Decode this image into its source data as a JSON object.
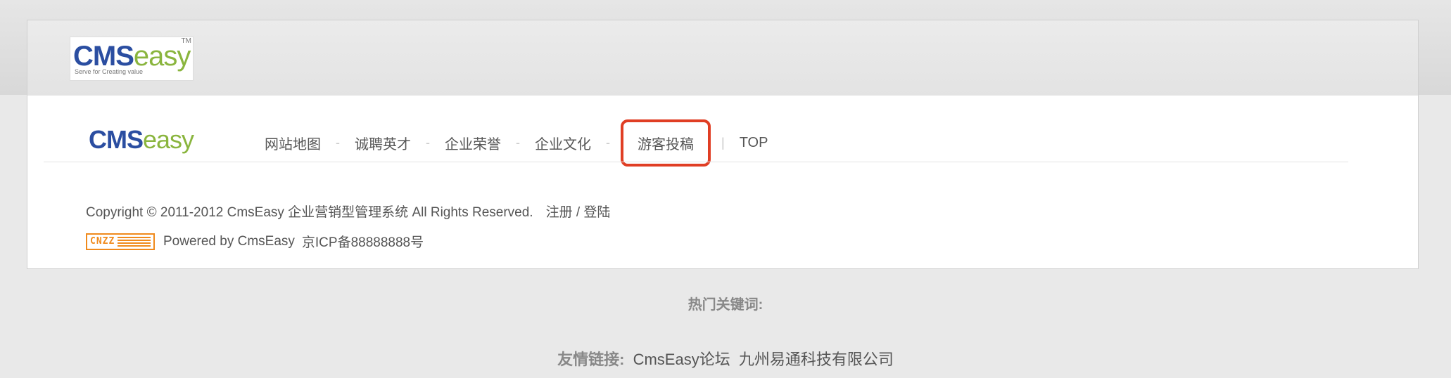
{
  "header": {
    "logo": {
      "cms": "CMS",
      "easy": "easy",
      "tm": "TM",
      "tagline": "Serve for Creating value"
    }
  },
  "footer": {
    "logo": {
      "cms": "CMS",
      "easy": "easy"
    },
    "nav": [
      {
        "label": "网站地图"
      },
      {
        "label": "诚聘英才"
      },
      {
        "label": "企业荣誉"
      },
      {
        "label": "企业文化"
      },
      {
        "label": "游客投稿",
        "highlighted": true
      },
      {
        "label": "TOP"
      }
    ],
    "separators": [
      "-",
      "-",
      "-",
      "-",
      "|"
    ],
    "copyright": "Copyright © 2011-2012 CmsEasy 企业营销型管理系统 All Rights Reserved.",
    "register_login": "注册 / 登陆",
    "cnzz_badge": "CNZZ",
    "powered_by": "Powered by CmsEasy",
    "icp": "京ICP备88888888号"
  },
  "hot_keywords_label": "热门关键词:",
  "friend_links": {
    "label": "友情链接:",
    "items": [
      "CmsEasy论坛",
      "九州易通科技有限公司"
    ]
  },
  "colors": {
    "highlight_border": "#e03e24",
    "logo_blue": "#2b4ea1",
    "logo_green": "#8ab53e",
    "cnzz_orange": "#f08a1c"
  }
}
